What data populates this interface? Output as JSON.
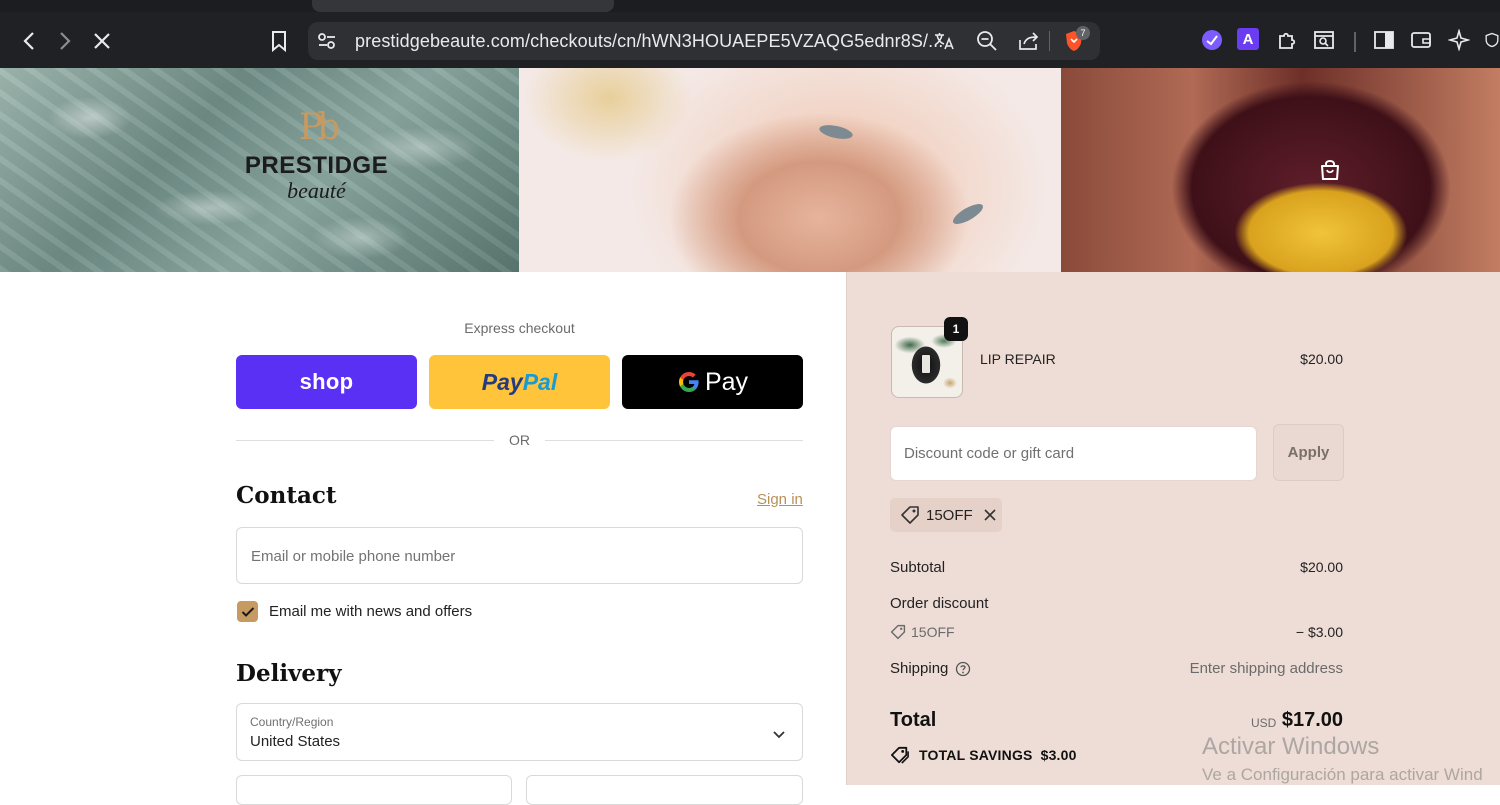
{
  "browser": {
    "url": "prestidgebeaute.com/checkouts/cn/hWN3HOUAEPE5VZAQG5ednr8S/...",
    "shield_count": "7",
    "nav_icons": [
      "back-icon",
      "forward-icon",
      "stop-loading-icon",
      "bookmark-icon",
      "site-settings-icon",
      "translate-icon",
      "zoom-out-icon",
      "share-icon"
    ],
    "extension_letter": "A"
  },
  "brand": {
    "mark": "Pb",
    "name": "PRESTIDGE",
    "sub": "beauté"
  },
  "checkout": {
    "express_label": "Express checkout",
    "shop_label": "shop",
    "paypal_label": "PayPal",
    "gpay_label": "Pay",
    "or_label": "OR",
    "contact_title": "Contact",
    "sign_in": "Sign in",
    "email_placeholder": "Email or mobile phone number",
    "news_label": "Email me with news and offers",
    "news_checked": true,
    "delivery_title": "Delivery",
    "country_label": "Country/Region",
    "country_value": "United States"
  },
  "order": {
    "item": {
      "name": "LIP REPAIR",
      "price": "$20.00",
      "quantity": "1"
    },
    "discount_placeholder": "Discount code or gift card",
    "apply_label": "Apply",
    "applied_code": "15OFF",
    "subtotal_label": "Subtotal",
    "subtotal_value": "$20.00",
    "order_discount_label": "Order discount",
    "discount_code": "15OFF",
    "discount_value": "− $3.00",
    "shipping_label": "Shipping",
    "shipping_value": "Enter shipping address",
    "total_label": "Total",
    "total_currency": "USD",
    "total_value": "$17.00",
    "savings_label": "TOTAL SAVINGS",
    "savings_value": "$3.00"
  },
  "colors": {
    "shop": "#5a31f4",
    "paypal": "#ffc439",
    "gpay": "#000000",
    "accent": "#c79a62",
    "summary_bg": "#eeddd6"
  },
  "watermark": {
    "title": "Activar Windows",
    "subtitle": "Ve a Configuración para activar Wind"
  }
}
